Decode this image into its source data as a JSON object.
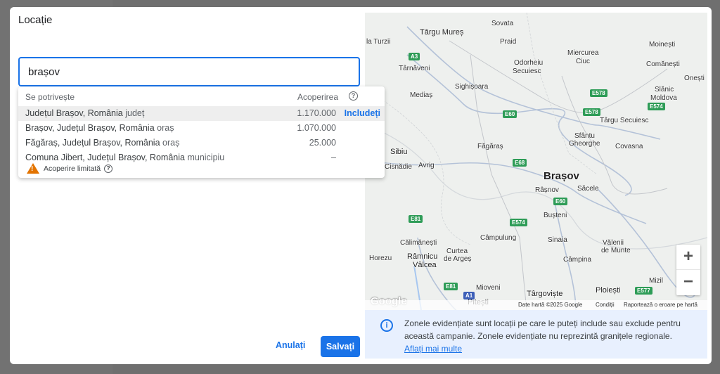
{
  "dialog": {
    "title": "Locație",
    "search_value": "brașov",
    "dropdown": {
      "col_match": "Se potrivește",
      "col_coverage": "Acoperirea",
      "rows": [
        {
          "name": "Județul Brașov, România",
          "type": "județ",
          "coverage": "1.170.000",
          "action": "Includeți"
        },
        {
          "name": "Brașov, Județul Brașov, România",
          "type": "oraș",
          "coverage": "1.070.000",
          "action": ""
        },
        {
          "name": "Făgăraș, Județul Brașov, România",
          "type": "oraș",
          "coverage": "25.000",
          "action": ""
        },
        {
          "name": "Comuna Jibert, Județul Brașov, România",
          "type": "municipiu",
          "coverage": "–",
          "action": ""
        }
      ],
      "limited_label": "Acoperire limitată"
    },
    "cancel_label": "Anulați",
    "save_label": "Salvați"
  },
  "map": {
    "places": {
      "targu_mures": "Târgu Mureș",
      "sovata": "Sovata",
      "praid": "Praid",
      "moinesti": "Moinești",
      "turzii": "la Turzii",
      "odorheiu": "Odorheiu",
      "secuiesc": "Secuiesc",
      "miercurea": "Miercurea",
      "ciuc": "Ciuc",
      "comanesti": "Comănești",
      "onesti": "Onești",
      "tarnaveni": "Târnăveni",
      "sighisoara": "Sighișoara",
      "slanic": "Slănic",
      "moldova": "Moldova",
      "medias": "Mediaș",
      "tg_secuiesc": "Târgu Secuiesc",
      "sfantu": "Sfântu",
      "gheorghe": "Gheorghe",
      "sibiu": "Sibiu",
      "fagaras": "Făgăraș",
      "covasna": "Covasna",
      "cisnadie": "Cisnădie",
      "avrig": "Avrig",
      "brasov": "Brașov",
      "rasnov": "Râșnov",
      "sacele": "Săcele",
      "busteni": "Bușteni",
      "calimanesti": "Călimănești",
      "campulung": "Câmpulung",
      "sinaia": "Sinaia",
      "valenii": "Vălenii",
      "de_munte": "de Munte",
      "horezu": "Horezu",
      "ramnicu": "Râmnicu",
      "valcea": "Vâlcea",
      "curtea": "Curtea",
      "de_arges": "de Argeș",
      "campina": "Câmpina",
      "mioveni": "Mioveni",
      "targoviste": "Târgoviște",
      "pitesti": "Pitești",
      "ploiesti": "Ploiești",
      "mizil": "Mizil"
    },
    "shields": {
      "a3": "A3",
      "e578a": "E578",
      "e578b": "E578",
      "e574a": "E574",
      "e60a": "E60",
      "e68": "E68",
      "e60b": "E60",
      "e81a": "E81",
      "e574b": "E574",
      "e81b": "E81",
      "a1": "A1",
      "e577": "E577"
    },
    "zoom_in": "+",
    "zoom_out": "−",
    "logo": "Google",
    "attrib_data": "Date hartă ©2025 Google",
    "attrib_terms": "Condiții",
    "attrib_report": "Raportează o eroare pe hartă"
  },
  "info": {
    "text": "Zonele evidențiate sunt locații pe care le puteți include sau exclude pentru această campanie. Zonele evidențiate nu reprezintă granițele regionale.",
    "link": "Aflați mai multe"
  }
}
